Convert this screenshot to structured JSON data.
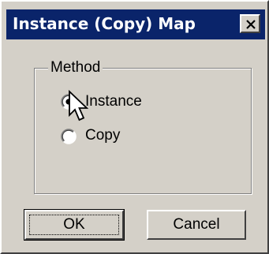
{
  "window": {
    "title": "Instance (Copy) Map",
    "close_icon": "close-x-icon",
    "colors": {
      "titlebar": "#0a246a",
      "face": "#d4d0c8",
      "title_text": "#ffffff"
    }
  },
  "method": {
    "legend": "Method",
    "options": [
      {
        "label": "Instance",
        "selected": true
      },
      {
        "label": "Copy",
        "selected": false
      }
    ]
  },
  "cursor_icon": "arrow-pointer-icon",
  "buttons": {
    "ok_label": "OK",
    "cancel_label": "Cancel"
  }
}
